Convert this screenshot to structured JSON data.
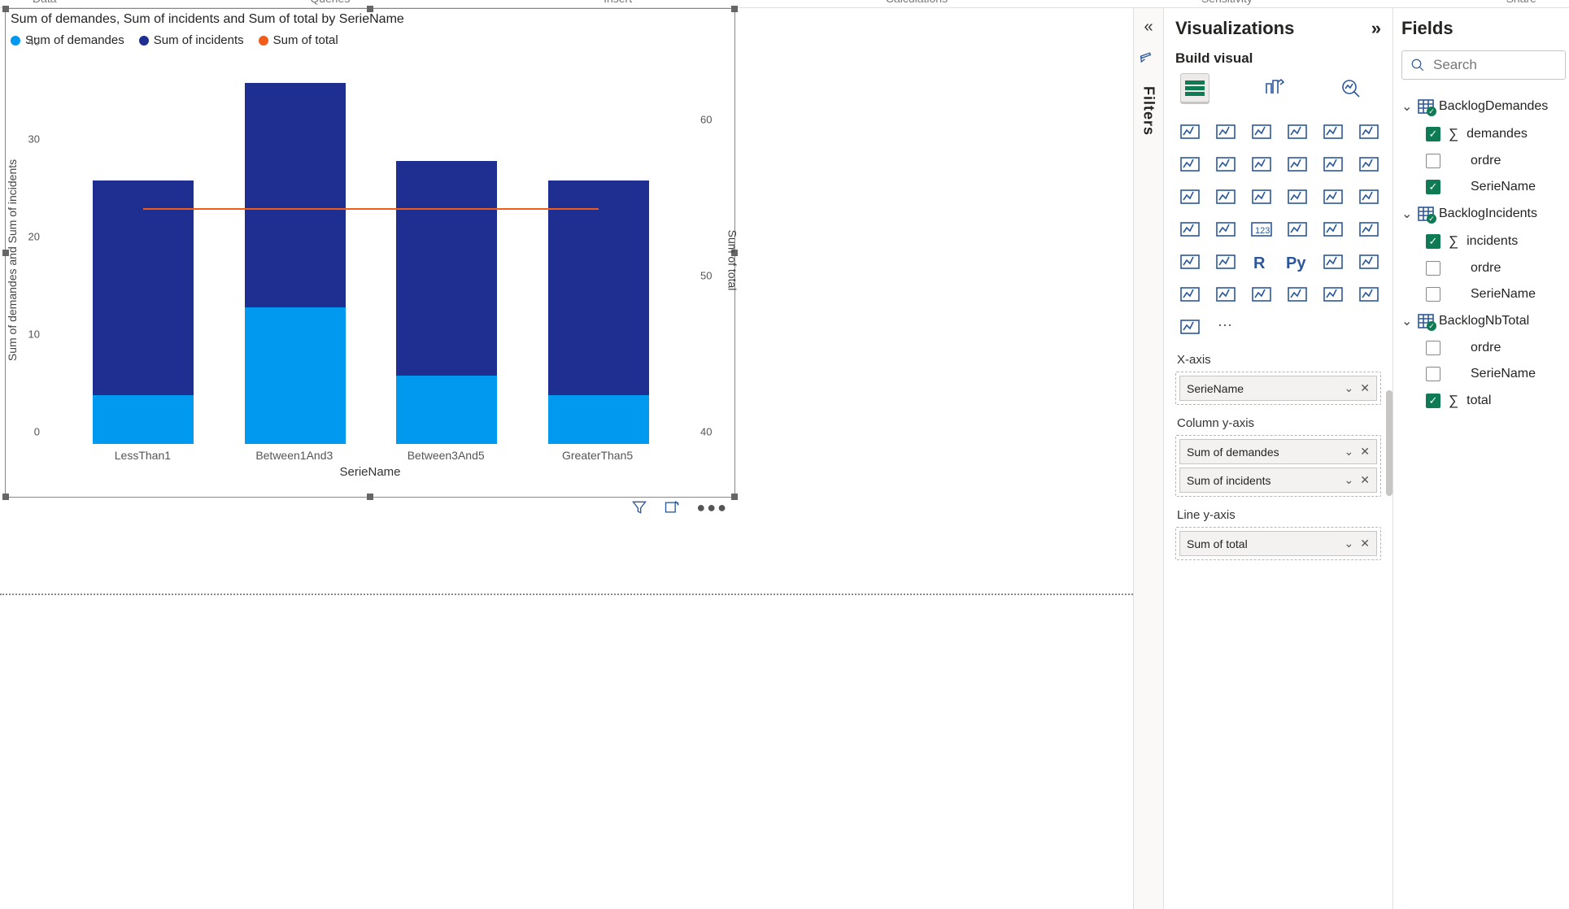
{
  "ribbon": {
    "data": "Data",
    "queries": "Queries",
    "insert": "Insert",
    "calculations": "Calculations",
    "sensitivity": "Sensitivity",
    "share": "Share"
  },
  "chart": {
    "title": "Sum of demandes, Sum of incidents and Sum of total by SerieName",
    "legend": {
      "demandes": "Sum of demandes",
      "incidents": "Sum of incidents",
      "total": "Sum of total"
    },
    "ylabel_left": "Sum of demandes and Sum of incidents",
    "ylabel_right": "Sum of total",
    "xlabel": "SerieName"
  },
  "chart_data": {
    "type": "bar",
    "categories": [
      "LessThan1",
      "Between1And3",
      "Between3And5",
      "GreaterThan5"
    ],
    "series": [
      {
        "name": "Sum of demandes",
        "values": [
          5,
          14,
          7,
          5
        ]
      },
      {
        "name": "Sum of incidents",
        "values": [
          22,
          23,
          22,
          22
        ]
      }
    ],
    "line_series": {
      "name": "Sum of total",
      "values": [
        55,
        55,
        55,
        55
      ]
    },
    "ylim_left": [
      0,
      40
    ],
    "yticks_left": [
      0,
      10,
      20,
      30,
      40
    ],
    "ylim_right": [
      40,
      65
    ],
    "yticks_right": [
      40,
      50,
      60
    ],
    "colors": {
      "demandes": "#0099f0",
      "incidents": "#1e2e91",
      "total": "#f25c19"
    }
  },
  "filters": {
    "label": "Filters"
  },
  "viz": {
    "title": "Visualizations",
    "build": "Build visual",
    "wells": {
      "xaxis": {
        "label": "X-axis",
        "items": [
          "SerieName"
        ]
      },
      "colY": {
        "label": "Column y-axis",
        "items": [
          "Sum of demandes",
          "Sum of incidents"
        ]
      },
      "lineY": {
        "label": "Line y-axis",
        "items": [
          "Sum of total"
        ]
      }
    }
  },
  "fields": {
    "title": "Fields",
    "search_placeholder": "Search",
    "tables": [
      {
        "name": "BacklogDemandes",
        "hasSelected": true,
        "fields": [
          {
            "name": "demandes",
            "checked": true,
            "agg": true
          },
          {
            "name": "ordre",
            "checked": false,
            "agg": false
          },
          {
            "name": "SerieName",
            "checked": true,
            "agg": false
          }
        ]
      },
      {
        "name": "BacklogIncidents",
        "hasSelected": true,
        "fields": [
          {
            "name": "incidents",
            "checked": true,
            "agg": true
          },
          {
            "name": "ordre",
            "checked": false,
            "agg": false
          },
          {
            "name": "SerieName",
            "checked": false,
            "agg": false
          }
        ]
      },
      {
        "name": "BacklogNbTotal",
        "hasSelected": true,
        "fields": [
          {
            "name": "ordre",
            "checked": false,
            "agg": false
          },
          {
            "name": "SerieName",
            "checked": false,
            "agg": false
          },
          {
            "name": "total",
            "checked": true,
            "agg": true
          }
        ]
      }
    ]
  }
}
